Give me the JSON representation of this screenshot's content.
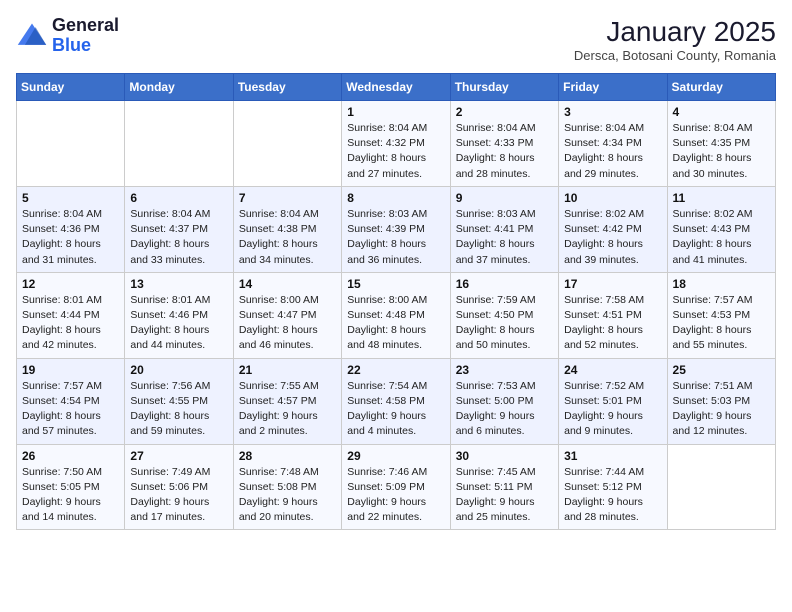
{
  "header": {
    "logo_general": "General",
    "logo_blue": "Blue",
    "month_title": "January 2025",
    "subtitle": "Dersca, Botosani County, Romania"
  },
  "weekdays": [
    "Sunday",
    "Monday",
    "Tuesday",
    "Wednesday",
    "Thursday",
    "Friday",
    "Saturday"
  ],
  "weeks": [
    [
      {
        "day": "",
        "info": ""
      },
      {
        "day": "",
        "info": ""
      },
      {
        "day": "",
        "info": ""
      },
      {
        "day": "1",
        "info": "Sunrise: 8:04 AM\nSunset: 4:32 PM\nDaylight: 8 hours and 27 minutes."
      },
      {
        "day": "2",
        "info": "Sunrise: 8:04 AM\nSunset: 4:33 PM\nDaylight: 8 hours and 28 minutes."
      },
      {
        "day": "3",
        "info": "Sunrise: 8:04 AM\nSunset: 4:34 PM\nDaylight: 8 hours and 29 minutes."
      },
      {
        "day": "4",
        "info": "Sunrise: 8:04 AM\nSunset: 4:35 PM\nDaylight: 8 hours and 30 minutes."
      }
    ],
    [
      {
        "day": "5",
        "info": "Sunrise: 8:04 AM\nSunset: 4:36 PM\nDaylight: 8 hours and 31 minutes."
      },
      {
        "day": "6",
        "info": "Sunrise: 8:04 AM\nSunset: 4:37 PM\nDaylight: 8 hours and 33 minutes."
      },
      {
        "day": "7",
        "info": "Sunrise: 8:04 AM\nSunset: 4:38 PM\nDaylight: 8 hours and 34 minutes."
      },
      {
        "day": "8",
        "info": "Sunrise: 8:03 AM\nSunset: 4:39 PM\nDaylight: 8 hours and 36 minutes."
      },
      {
        "day": "9",
        "info": "Sunrise: 8:03 AM\nSunset: 4:41 PM\nDaylight: 8 hours and 37 minutes."
      },
      {
        "day": "10",
        "info": "Sunrise: 8:02 AM\nSunset: 4:42 PM\nDaylight: 8 hours and 39 minutes."
      },
      {
        "day": "11",
        "info": "Sunrise: 8:02 AM\nSunset: 4:43 PM\nDaylight: 8 hours and 41 minutes."
      }
    ],
    [
      {
        "day": "12",
        "info": "Sunrise: 8:01 AM\nSunset: 4:44 PM\nDaylight: 8 hours and 42 minutes."
      },
      {
        "day": "13",
        "info": "Sunrise: 8:01 AM\nSunset: 4:46 PM\nDaylight: 8 hours and 44 minutes."
      },
      {
        "day": "14",
        "info": "Sunrise: 8:00 AM\nSunset: 4:47 PM\nDaylight: 8 hours and 46 minutes."
      },
      {
        "day": "15",
        "info": "Sunrise: 8:00 AM\nSunset: 4:48 PM\nDaylight: 8 hours and 48 minutes."
      },
      {
        "day": "16",
        "info": "Sunrise: 7:59 AM\nSunset: 4:50 PM\nDaylight: 8 hours and 50 minutes."
      },
      {
        "day": "17",
        "info": "Sunrise: 7:58 AM\nSunset: 4:51 PM\nDaylight: 8 hours and 52 minutes."
      },
      {
        "day": "18",
        "info": "Sunrise: 7:57 AM\nSunset: 4:53 PM\nDaylight: 8 hours and 55 minutes."
      }
    ],
    [
      {
        "day": "19",
        "info": "Sunrise: 7:57 AM\nSunset: 4:54 PM\nDaylight: 8 hours and 57 minutes."
      },
      {
        "day": "20",
        "info": "Sunrise: 7:56 AM\nSunset: 4:55 PM\nDaylight: 8 hours and 59 minutes."
      },
      {
        "day": "21",
        "info": "Sunrise: 7:55 AM\nSunset: 4:57 PM\nDaylight: 9 hours and 2 minutes."
      },
      {
        "day": "22",
        "info": "Sunrise: 7:54 AM\nSunset: 4:58 PM\nDaylight: 9 hours and 4 minutes."
      },
      {
        "day": "23",
        "info": "Sunrise: 7:53 AM\nSunset: 5:00 PM\nDaylight: 9 hours and 6 minutes."
      },
      {
        "day": "24",
        "info": "Sunrise: 7:52 AM\nSunset: 5:01 PM\nDaylight: 9 hours and 9 minutes."
      },
      {
        "day": "25",
        "info": "Sunrise: 7:51 AM\nSunset: 5:03 PM\nDaylight: 9 hours and 12 minutes."
      }
    ],
    [
      {
        "day": "26",
        "info": "Sunrise: 7:50 AM\nSunset: 5:05 PM\nDaylight: 9 hours and 14 minutes."
      },
      {
        "day": "27",
        "info": "Sunrise: 7:49 AM\nSunset: 5:06 PM\nDaylight: 9 hours and 17 minutes."
      },
      {
        "day": "28",
        "info": "Sunrise: 7:48 AM\nSunset: 5:08 PM\nDaylight: 9 hours and 20 minutes."
      },
      {
        "day": "29",
        "info": "Sunrise: 7:46 AM\nSunset: 5:09 PM\nDaylight: 9 hours and 22 minutes."
      },
      {
        "day": "30",
        "info": "Sunrise: 7:45 AM\nSunset: 5:11 PM\nDaylight: 9 hours and 25 minutes."
      },
      {
        "day": "31",
        "info": "Sunrise: 7:44 AM\nSunset: 5:12 PM\nDaylight: 9 hours and 28 minutes."
      },
      {
        "day": "",
        "info": ""
      }
    ]
  ]
}
